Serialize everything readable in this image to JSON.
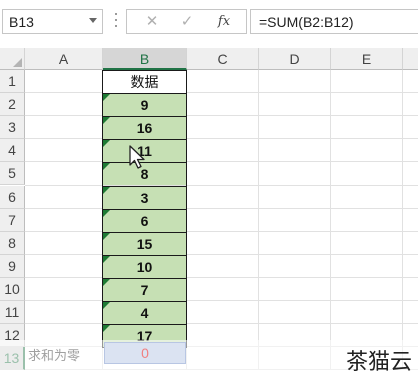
{
  "formula_bar": {
    "name_box": "B13",
    "cancel_icon": "✕",
    "enter_icon": "✓",
    "fx_label": "fx",
    "formula": "=SUM(B2:B12)"
  },
  "columns": [
    "A",
    "B",
    "C",
    "D",
    "E"
  ],
  "selected_column": "B",
  "rows": [
    "1",
    "2",
    "3",
    "4",
    "5",
    "6",
    "7",
    "8",
    "9",
    "10",
    "11",
    "12",
    "13"
  ],
  "selected_row": "13",
  "column_b": {
    "header": "数据",
    "values": [
      "9",
      "16",
      "11",
      "8",
      "3",
      "6",
      "15",
      "10",
      "7",
      "4",
      "17"
    ]
  },
  "row13": {
    "a_label": "求和为零",
    "b_result": "0"
  },
  "colors": {
    "data_fill": "#c6e0b4",
    "error_triangle": "#1e7a34",
    "selected_header": "#217346",
    "result_text": "#f08080"
  },
  "icons": {
    "cursor": "mouse-pointer-icon",
    "name_box_dropdown": "chevron-down-icon"
  },
  "watermark": "茶猫云"
}
